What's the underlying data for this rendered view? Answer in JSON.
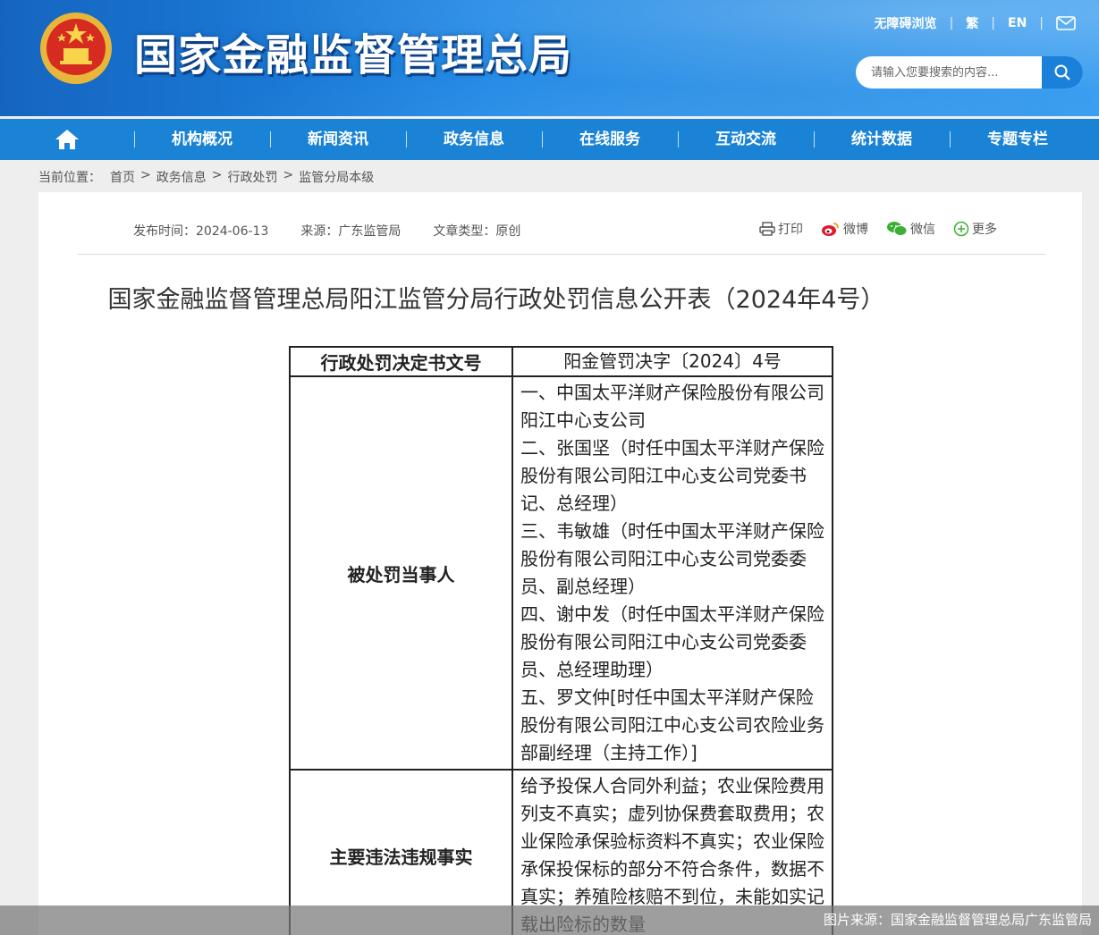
{
  "header": {
    "site_title": "国家金融监督管理总局",
    "top_links": [
      "无障碍浏览",
      "繁",
      "EN"
    ],
    "mail_icon": "mail-icon",
    "search_placeholder": "请输入您要搜索的内容...",
    "search_icon": "search-icon"
  },
  "nav": {
    "home_icon": "home-icon",
    "items": [
      "机构概况",
      "新闻资讯",
      "政务信息",
      "在线服务",
      "互动交流",
      "统计数据",
      "专题专栏"
    ]
  },
  "breadcrumb": {
    "label": "当前位置：",
    "items": [
      "首页",
      "政务信息",
      "行政处罚",
      "监管分局本级"
    ],
    "separator": ">"
  },
  "meta": {
    "publish_time": "发布时间：2024-06-13",
    "source": "来源：广东监管局",
    "type": "文章类型：原创"
  },
  "share": {
    "print": "打印",
    "weibo": "微博",
    "wechat": "微信",
    "more": "更多"
  },
  "document": {
    "title": "国家金融监督管理总局阳江监管分局行政处罚信息公开表（2024年4号）",
    "rows": [
      {
        "label": "行政处罚决定书文号",
        "value": [
          "阳金管罚决字〔2024〕4号"
        ]
      },
      {
        "label": "被处罚当事人",
        "value": [
          "一、中国太平洋财产保险股份有限公司阳江中心支公司",
          "二、张国坚（时任中国太平洋财产保险股份有限公司阳江中心支公司党委书记、总经理）",
          "三、韦敏雄（时任中国太平洋财产保险股份有限公司阳江中心支公司党委委员、副总经理）",
          "四、谢中发（时任中国太平洋财产保险股份有限公司阳江中心支公司党委委员、总经理助理）",
          "五、罗文仲[时任中国太平洋财产保险股份有限公司阳江中心支公司农险业务部副经理（主持工作）]"
        ]
      },
      {
        "label": "主要违法违规事实",
        "value": [
          "给予投保人合同外利益；农业保险费用列支不真实；虚列协保费套取费用；农业保险承保验标资料不真实；农业保险承保投保标的部分不符合条件，数据不真实；养殖险核赔不到位，未能如实记载出险标的数量"
        ]
      }
    ]
  },
  "caption": "图片来源：国家金融监督管理总局广东监管局",
  "colors": {
    "header_blue": "#1e88e5",
    "nav_blue": "#1a83d6",
    "page_bg": "#eeeeee"
  }
}
